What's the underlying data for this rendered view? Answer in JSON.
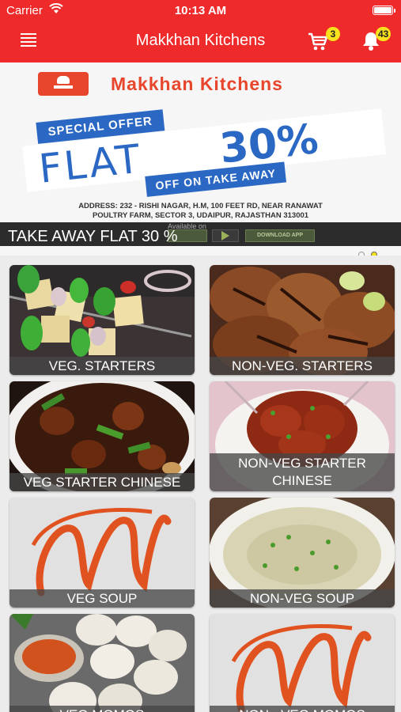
{
  "status_bar": {
    "carrier": "Carrier",
    "time": "10:13 AM",
    "battery_level": 1.0
  },
  "nav_bar": {
    "title": "Makkhan Kitchens",
    "cart_badge": "3",
    "notifications_badge": "43"
  },
  "banner": {
    "brand": "Makkhan Kitchens",
    "special_offer": "SPECIAL OFFER",
    "flat_text": "FLAT",
    "percent_text": "30%",
    "takeaway_text": "OFF ON TAKE AWAY",
    "address_line1": "ADDRESS: 232 - RISHI NAGAR, H.M, 100 FEET RD, NEAR RANAWAT",
    "address_line2": "POULTRY FARM, SECTOR 3, UDAIPUR, RAJASTHAN 313001",
    "available_on": "Available on",
    "download_app": "DOWNLOAD APP",
    "caption": "TAKE AWAY FLAT  30 %",
    "slide_count": 2,
    "active_slide": 2
  },
  "categories": [
    {
      "label": "VEG. STARTERS"
    },
    {
      "label": "NON-VEG. STARTERS"
    },
    {
      "label": "VEG STARTER CHINESE"
    },
    {
      "label": "NON-VEG STARTER CHINESE"
    },
    {
      "label": "VEG SOUP"
    },
    {
      "label": "NON-VEG SOUP"
    },
    {
      "label": "VEG MOMOS"
    },
    {
      "label": "NON - VEG MOMOS"
    }
  ],
  "colors": {
    "header": "#ee2a2a",
    "badge": "#f7e21d",
    "banner_blue": "#2b68c4",
    "brand_orange": "#e8462c"
  },
  "icons": [
    "menu-icon",
    "cart-icon",
    "bell-icon",
    "wifi-icon",
    "battery-icon"
  ]
}
